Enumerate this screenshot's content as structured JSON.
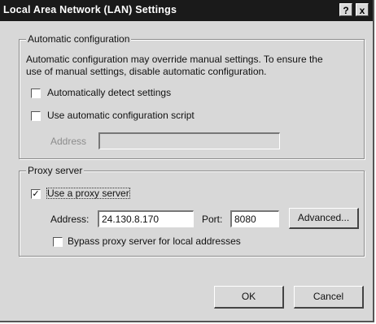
{
  "window": {
    "title": "Local Area Network (LAN) Settings",
    "help_glyph": "?",
    "close_glyph": "x"
  },
  "auto_config": {
    "legend": "Automatic configuration",
    "description_line1": "Automatic configuration may override manual settings.  To ensure the",
    "description_line2": "use of manual settings, disable automatic configuration.",
    "auto_detect_label": "Automatically detect settings",
    "auto_detect_checked": false,
    "script_label": "Use automatic configuration script",
    "script_checked": false,
    "address_label": "Address",
    "address_value": ""
  },
  "proxy": {
    "legend": "Proxy server",
    "use_proxy_label": "Use a proxy server",
    "use_proxy_checked": true,
    "check_glyph": "✓",
    "address_label": "Address:",
    "address_value": "24.130.8.170",
    "port_label": "Port:",
    "port_value": "8080",
    "advanced_label": "Advanced...",
    "bypass_label": "Bypass proxy server for local addresses",
    "bypass_checked": false
  },
  "buttons": {
    "ok_label": "OK",
    "cancel_label": "Cancel"
  }
}
